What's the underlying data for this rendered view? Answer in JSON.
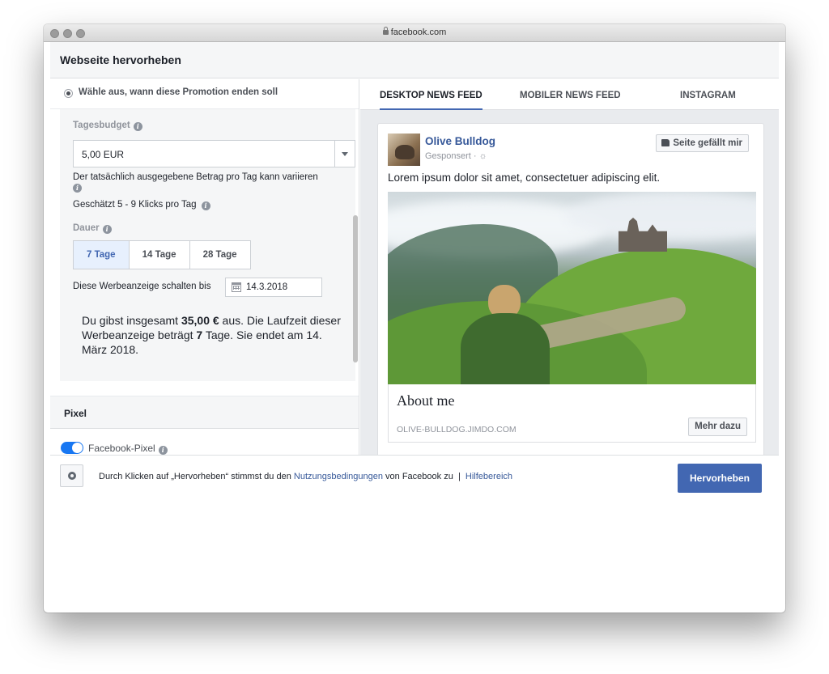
{
  "browser": {
    "url": "facebook.com"
  },
  "dialog": {
    "title": "Webseite hervorheben"
  },
  "left": {
    "radio_label": "Wähle aus, wann diese Promotion enden soll",
    "budget_label": "Tagesbudget",
    "budget_value": "5,00 EUR",
    "budget_note": "Der tatsächlich ausgegebene Betrag pro Tag kann variieren",
    "estimate": "Geschätzt 5 - 9 Klicks pro Tag",
    "duration_label": "Dauer",
    "durations": [
      "7 Tage",
      "14 Tage",
      "28 Tage"
    ],
    "run_until_label": "Diese Werbeanzeige schalten bis",
    "run_until_value": "14.3.2018",
    "summary": {
      "part1": "Du gibst insgesamt ",
      "amount": "35,00 €",
      "part2": " aus. Die Laufzeit dieser Werbeanzeige beträgt ",
      "days": "7",
      "part3": " Tage. Sie endet am 14. März 2018."
    },
    "pixel_title": "Pixel",
    "pixel_toggle_label": "Facebook-Pixel"
  },
  "right": {
    "tabs": [
      "DESKTOP NEWS FEED",
      "MOBILER NEWS FEED",
      "INSTAGRAM"
    ],
    "page_name": "Olive Bulldog",
    "sponsored": "Gesponsert · ",
    "like_button": "Seite gefällt mir",
    "post_text": "Lorem ipsum dolor sit amet, consectetuer adipiscing elit.",
    "headline": "About me",
    "domain": "OLIVE-BULLDOG.JIMDO.COM",
    "cta": "Mehr dazu"
  },
  "footer": {
    "text_before": "Durch Klicken auf „Hervorheben“ stimmst du den ",
    "terms_link": "Nutzungsbedingungen",
    "text_after": " von Facebook zu",
    "separator": "  |  ",
    "help_link": "Hilfebereich",
    "primary_button": "Hervorheben"
  },
  "colors": {
    "accent": "#4267b2",
    "link": "#365899"
  }
}
